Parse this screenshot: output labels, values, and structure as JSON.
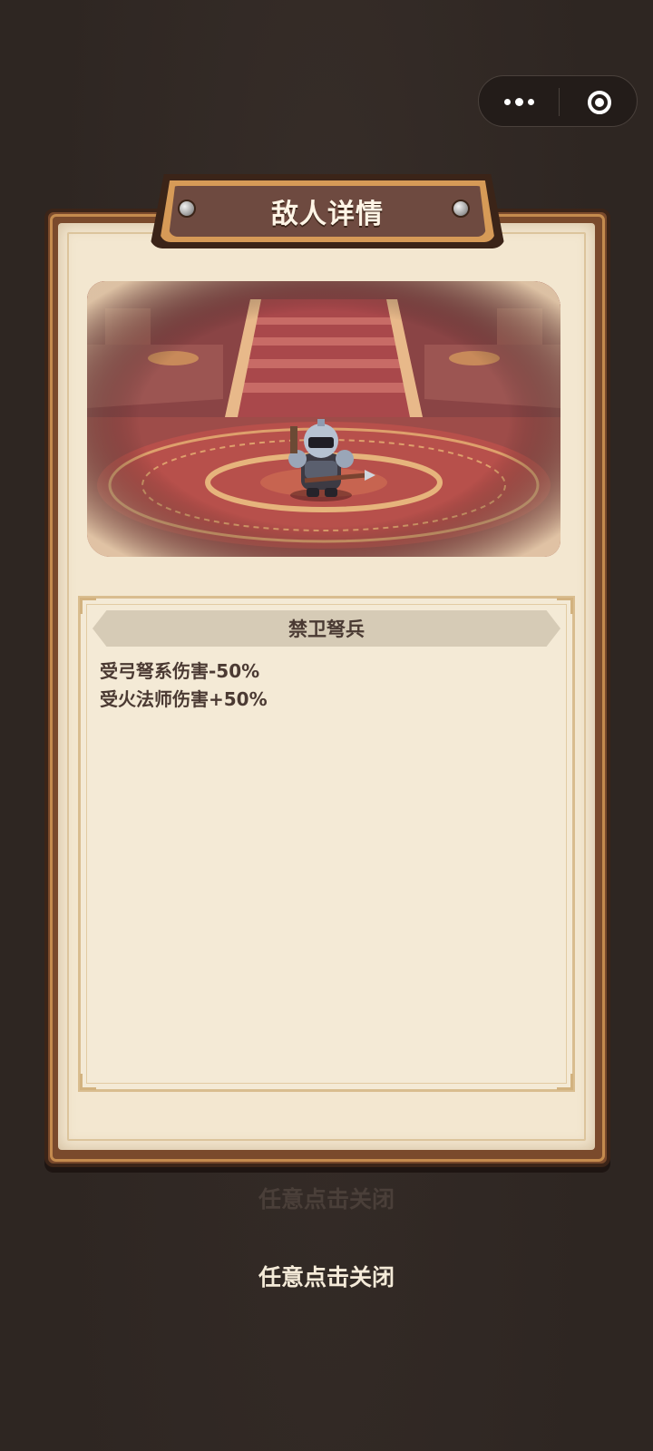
{
  "header": {
    "title": "敌人详情"
  },
  "capsule": {
    "more_icon": "more-dots-icon",
    "close_icon": "target-close-icon"
  },
  "enemy": {
    "name": "禁卫弩兵",
    "traits": [
      "受弓弩系伤害-50%",
      "受火法师伤害+50%"
    ]
  },
  "background_hint": "任意点击关闭",
  "close_hint": "任意点击关闭",
  "colors": {
    "background": "#2e2622",
    "frame": "#7a4a2c",
    "paper": "#f3e7d0",
    "plaque": "#6e4a40",
    "carpet": "#b9504a"
  }
}
